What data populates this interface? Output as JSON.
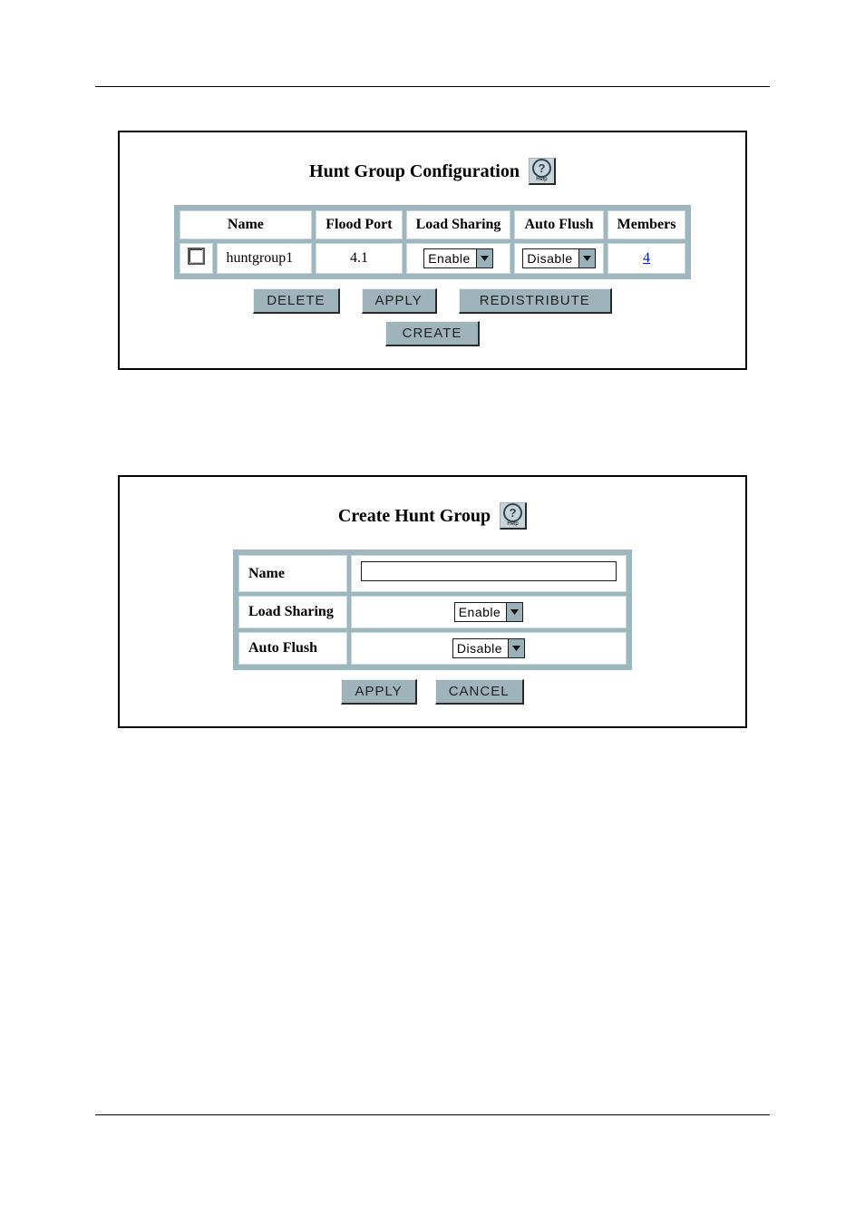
{
  "config_panel": {
    "title": "Hunt Group Configuration",
    "help_label": "Help",
    "help_glyph": "?",
    "headers": {
      "name": "Name",
      "flood_port": "Flood Port",
      "load_sharing": "Load Sharing",
      "auto_flush": "Auto Flush",
      "members": "Members"
    },
    "row": {
      "name": "huntgroup1",
      "flood_port": "4.1",
      "load_sharing_value": "Enable",
      "auto_flush_value": "Disable",
      "members": "4"
    },
    "buttons": {
      "delete": "DELETE",
      "apply": "APPLY",
      "redistribute": "REDISTRIBUTE",
      "create": "CREATE"
    }
  },
  "create_panel": {
    "title": "Create Hunt Group",
    "help_label": "Help",
    "help_glyph": "?",
    "fields": {
      "name_label": "Name",
      "name_value": "",
      "load_sharing_label": "Load Sharing",
      "load_sharing_value": "Enable",
      "auto_flush_label": "Auto Flush",
      "auto_flush_value": "Disable"
    },
    "buttons": {
      "apply": "APPLY",
      "cancel": "CANCEL"
    }
  }
}
